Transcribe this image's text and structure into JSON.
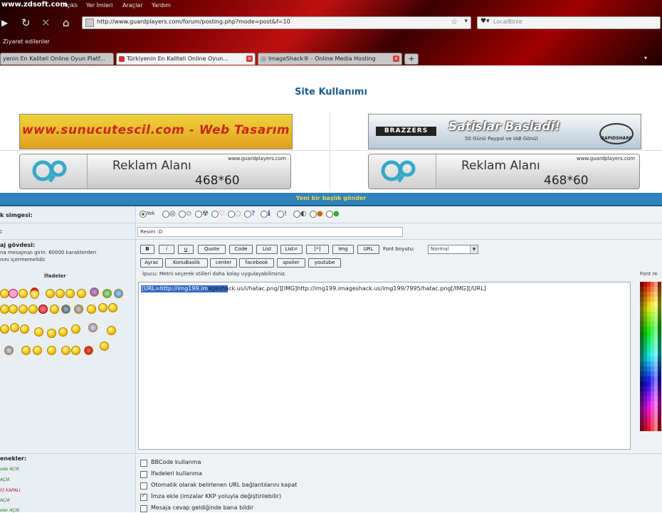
{
  "browser": {
    "logo_text": "www.zdsoft.com",
    "menu": [
      "Açıklı",
      "Yer İmleri",
      "Araçlar",
      "Yardım"
    ],
    "url": "http://www.guardplayers.com/forum/posting.php?mode=post&f=10",
    "search_placeholder": "LocalBinle",
    "bookmarks_label": "Ziyaret edilenler",
    "tabs": [
      {
        "title": "yenin En Kaliteli Online Oyun Platf..."
      },
      {
        "title": "Türkiyenin En Kaliteli Online Oyun..."
      },
      {
        "title": "ImageShack® - Online Media Hosting"
      }
    ],
    "tab_new_label": "+",
    "tab_list_label": "▾"
  },
  "page": {
    "title": "Site Kullanımı"
  },
  "ads": {
    "sunucu_text": "www.sunucutescil.com - Web Tasarım",
    "brazzers_logo": "BRAZZERS",
    "brazzers_headline": "Satislar Basladi!",
    "brazzers_sub": "50 Günü Paypal ve IAB Gönül",
    "rapidshare": "RAPIDSHARE",
    "reklam_label": "Reklam Alanı",
    "reklam_size": "468*60",
    "reklam_site": "www.guardplayers.com"
  },
  "form": {
    "header": "Yeni bir başlık gönder",
    "icon_label": "k simgesi:",
    "icon_none": "Yok",
    "subject_label": ":",
    "subject_value": "Resim :D",
    "body_label": "aj gövdesi:",
    "body_hint_1": "na mesajınızı girin. 60000 karakterden",
    "body_hint_2": "nını içermemelidir.",
    "smilies_title": "İfadeler",
    "buttons_row1": [
      "B",
      "i",
      "u",
      "Quote",
      "Code",
      "List",
      "List=",
      "[*]",
      "Img",
      "URL"
    ],
    "font_size_label": "Font boyutu:",
    "font_size_value": "Normal",
    "buttons_row2": [
      "Ayrac",
      "KonuBaslik",
      "center",
      "facebook",
      "spoiler",
      "youtube"
    ],
    "tip": "İpucu: Metni seçerek stilleri daha kolay uygulayabilirsiniz.",
    "font_color_label": "Font re",
    "body_selected": "[URL=http://img199.im",
    "body_rest": "ageshack.us/i/hatac.png/][IMG]http://img199.imageshack.us/img199/7995/hatac.png[/IMG][/URL]",
    "options_label": "enekler:",
    "options_left": [
      {
        "text": "ode AÇIK",
        "color": "#2a7a2a"
      },
      {
        "text": "AÇIK",
        "color": "#2a7a2a"
      },
      {
        "text": "h] KAPALI",
        "color": "#b02020"
      },
      {
        "text": "AÇIK",
        "color": "#2a7a2a"
      },
      {
        "text": "eler AÇIK",
        "color": "#2a7a2a"
      }
    ],
    "options": [
      {
        "label": "BBCode kullanma",
        "checked": false
      },
      {
        "label": "İfadeleri kullanma",
        "checked": false
      },
      {
        "label": "Otomatik olarak belirlenen URL bağlantılarını kapat",
        "checked": false
      },
      {
        "label": "İmza ekle (imzalar KKP yoluyla değiştirilebilir)",
        "checked": true
      },
      {
        "label": "Mesaja cevap geldiğinde bana bildir",
        "checked": false
      }
    ]
  }
}
